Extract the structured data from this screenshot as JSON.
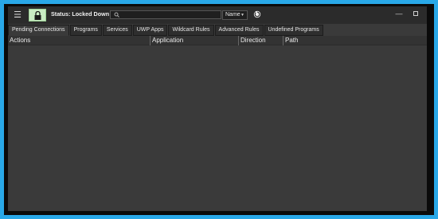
{
  "toolbar": {
    "menu_icon": "hamburger-menu-icon",
    "lock_icon": "lock-icon",
    "status": "Status: Locked Down",
    "search_placeholder": "",
    "sort_value": "Name",
    "refresh_icon": "refresh-icon",
    "lock_bg": "#c9ecc4"
  },
  "tabs": [
    {
      "label": "Pending Connections"
    },
    {
      "label": "Programs"
    },
    {
      "label": "Services"
    },
    {
      "label": "UWP Apps"
    },
    {
      "label": "Wildcard Rules"
    },
    {
      "label": "Advanced Rules"
    },
    {
      "label": "Undefined Programs"
    }
  ],
  "table": {
    "columns": [
      "Actions",
      "Application",
      "Direction",
      "Path"
    ]
  },
  "colors": {
    "desktop": "#29a8e8",
    "window": "#3a3a3a",
    "toolbar": "#2b2b2b"
  }
}
